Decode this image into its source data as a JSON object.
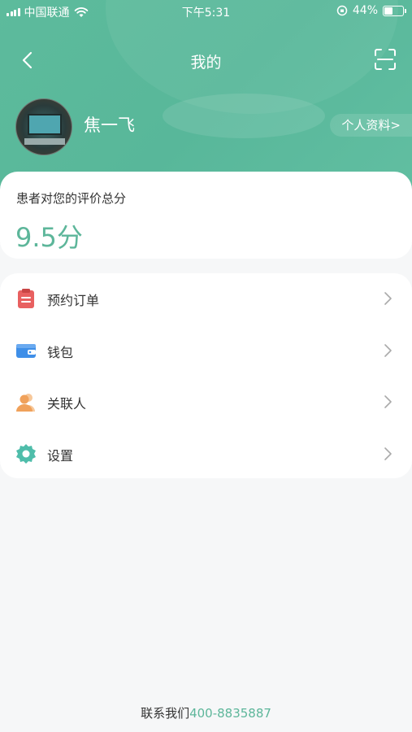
{
  "status_bar": {
    "carrier": "中国联通",
    "time": "下午5:31",
    "battery_percent": "44%",
    "battery_level": 0.44
  },
  "nav": {
    "title": "我的",
    "back_icon": "back-chevron-icon",
    "scan_icon": "scan-icon"
  },
  "profile": {
    "name": "焦一飞",
    "profile_link": "个人资料>"
  },
  "score": {
    "label": "患者对您的评价总分",
    "value": "9.5分"
  },
  "menu": {
    "items": [
      {
        "label": "预约订单",
        "icon": "clipboard-icon",
        "color": "#e86060"
      },
      {
        "label": "钱包",
        "icon": "wallet-icon",
        "color": "#3f8fe8"
      },
      {
        "label": "关联人",
        "icon": "user-icon",
        "color": "#f0a15a"
      },
      {
        "label": "设置",
        "icon": "gear-icon",
        "color": "#4fbdaa"
      }
    ]
  },
  "footer": {
    "label": "联系我们",
    "phone": "400-8835887"
  },
  "colors": {
    "primary": "#5db69a",
    "header_bg": "#5dbb9c",
    "page_bg": "#f6f7f8"
  }
}
